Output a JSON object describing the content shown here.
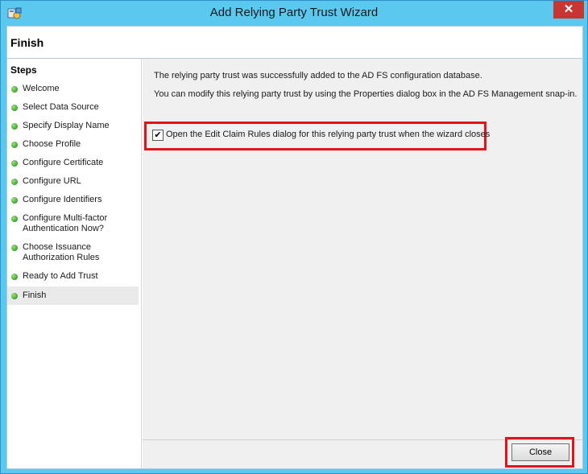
{
  "window": {
    "title": "Add Relying Party Trust Wizard",
    "close_symbol": "✕"
  },
  "header": {
    "title": "Finish"
  },
  "sidebar": {
    "title": "Steps",
    "items": [
      {
        "label": "Welcome"
      },
      {
        "label": "Select Data Source"
      },
      {
        "label": "Specify Display Name"
      },
      {
        "label": "Choose Profile"
      },
      {
        "label": "Configure Certificate"
      },
      {
        "label": "Configure URL"
      },
      {
        "label": "Configure Identifiers"
      },
      {
        "label": "Configure Multi-factor Authentication Now?"
      },
      {
        "label": "Choose Issuance Authorization Rules"
      },
      {
        "label": "Ready to Add Trust"
      },
      {
        "label": "Finish"
      }
    ]
  },
  "main": {
    "message1": "The relying party trust was successfully added to the AD FS configuration database.",
    "message2": "You can modify this relying party trust by using the Properties dialog box in the AD FS Management snap-in.",
    "checkbox": {
      "label": "Open the Edit Claim Rules dialog for this relying party trust when the wizard closes",
      "checked": true,
      "check_symbol": "✔"
    }
  },
  "footer": {
    "close_label": "Close"
  },
  "colors": {
    "title_bar": "#5bc8ef",
    "highlight": "#e3131c",
    "step_done": "#3aa52c"
  }
}
